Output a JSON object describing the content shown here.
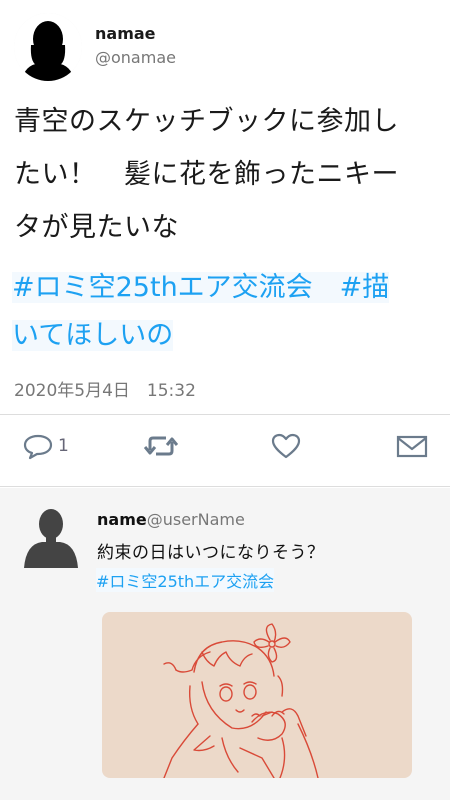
{
  "tweet": {
    "display_name": "namae",
    "handle": "@onamae",
    "body_lines": [
      "青空のスケッチブックに参加し",
      "たい！　髪に花を飾ったニキー",
      "タが見たいな"
    ],
    "hashtag_lines": [
      "#ロミ空25thエア交流会　#描",
      "いてほしいの"
    ],
    "timestamp": "2020年5月4日　15:32",
    "reply_count": "1"
  },
  "icons": {
    "reply": "speech-bubble-icon",
    "retweet": "retweet-icon",
    "like": "heart-icon",
    "message": "envelope-icon",
    "avatar": "person-silhouette-icon"
  },
  "reply": {
    "name": "name",
    "username": "@userName",
    "text": "約束の日はいつになりそう？",
    "hashtag": "#ロミ空25thエア交流会"
  },
  "colors": {
    "hashtag": "#1da1f2",
    "icon": "#6b7b8c",
    "sketch_bg": "#ecd9c9",
    "sketch_line": "#d94a38"
  }
}
